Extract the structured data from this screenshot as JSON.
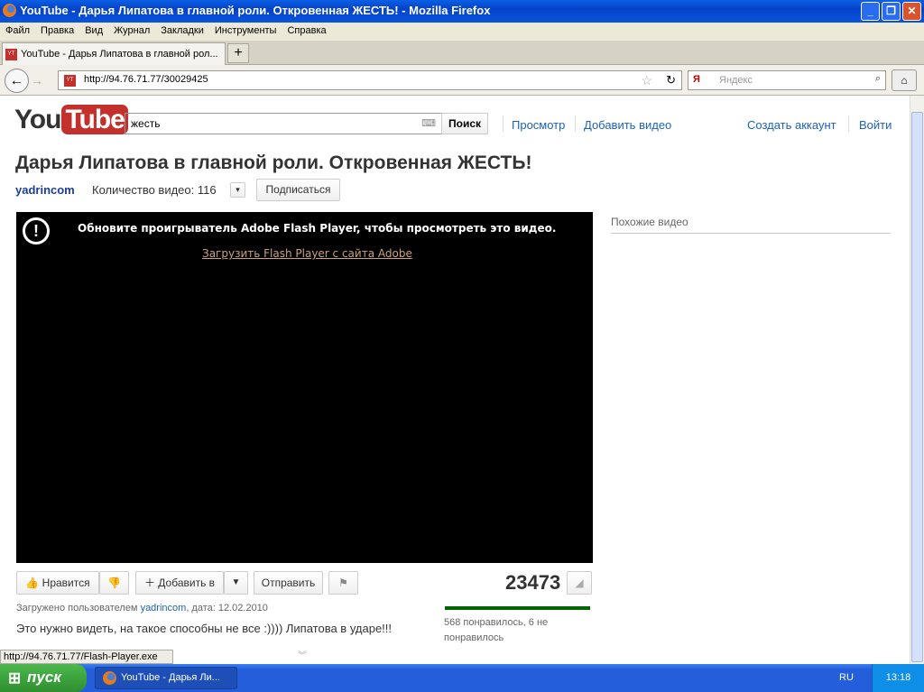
{
  "window": {
    "title": "YouTube - Дарья Липатова в главной роли. Откровенная ЖЕСТЬ! - Mozilla Firefox"
  },
  "menu": [
    "Файл",
    "Правка",
    "Вид",
    "Журнал",
    "Закладки",
    "Инструменты",
    "Справка"
  ],
  "tab": {
    "label": "YouTube - Дарья Липатова в главной рол..."
  },
  "nav": {
    "url": "http://94.76.71.77/30029425",
    "search_placeholder": "Яндекс"
  },
  "youtube": {
    "logo": {
      "you": "You",
      "tube": "Tube"
    },
    "search_value": "жесть",
    "search_button": "Поиск",
    "links": {
      "browse": "Просмотр",
      "upload": "Добавить видео",
      "create_account": "Создать аккаунт",
      "login": "Войти"
    },
    "title": "Дарья Липатова в главной роли. Откровенная ЖЕСТЬ!",
    "channel": "yadrincom",
    "video_count": "Количество видео: 116",
    "subscribe": "Подписаться",
    "player": {
      "message": "Обновите проигрыватель Adobe Flash Player, чтобы просмотреть это видео.",
      "download_link": "Загрузить Flash Player с сайта Adobe"
    },
    "related_title": "Похожие видео",
    "actions": {
      "like": "Нравится",
      "add_to": "Добавить в",
      "share": "Отправить"
    },
    "views": "23473",
    "uploaded_prefix": "Загружено пользователем ",
    "uploaded_user": "yadrincom",
    "uploaded_date": ", дата: 12.02.2010",
    "description": "Это нужно видеть, на такое способны не все :)))) Липатова в ударе!!!",
    "likes_text": "568 понравилось, 6 не понравилось",
    "like_ratio": 0.99
  },
  "status_bar": "http://94.76.71.77/Flash-Player.exe",
  "taskbar": {
    "start": "пуск",
    "task": "YouTube - Дарья Ли...",
    "lang": "RU",
    "clock": "13:18"
  }
}
